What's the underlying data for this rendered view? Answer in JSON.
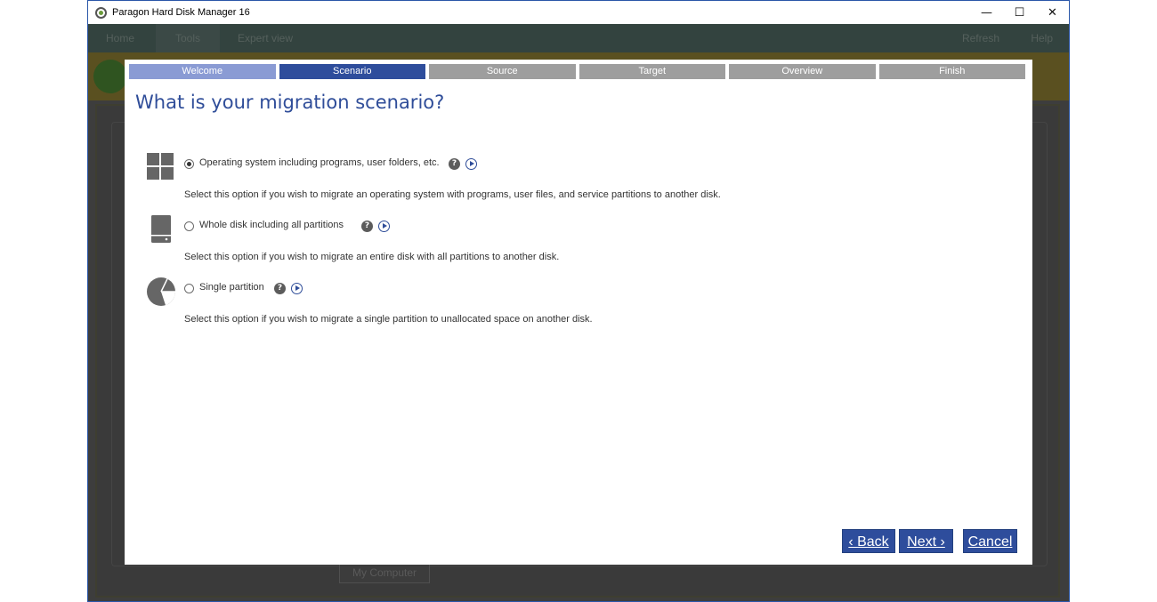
{
  "window": {
    "title": "Paragon Hard Disk Manager 16",
    "controls": {
      "minimize": "—",
      "maximize": "☐",
      "close": "✕"
    }
  },
  "background_app": {
    "menu": {
      "home": "Home",
      "tools": "Tools",
      "expert_view": "Expert view",
      "refresh": "Refresh",
      "help": "Help"
    },
    "my_computer_label": "My Computer"
  },
  "wizard": {
    "steps": [
      "Welcome",
      "Scenario",
      "Source",
      "Target",
      "Overview",
      "Finish"
    ],
    "active_step": "Scenario",
    "heading": "What is your migration scenario?",
    "options": [
      {
        "icon": "windows-logo-icon",
        "label": "Operating system including programs, user folders, etc.",
        "description": "Select this option if you wish to migrate an operating system with programs, user files, and service partitions to another disk.",
        "selected": true
      },
      {
        "icon": "hard-disk-icon",
        "label": "Whole disk including all partitions",
        "description": "Select this option if you wish to migrate an entire disk with all partitions to another disk.",
        "selected": false
      },
      {
        "icon": "pie-partition-icon",
        "label": "Single partition",
        "description": "Select this option if you wish to migrate a single partition to unallocated space on another disk.",
        "selected": false
      }
    ],
    "help_glyph": "?",
    "buttons": {
      "back": "‹ Back",
      "next": "Next ›",
      "cancel": "Cancel"
    }
  },
  "colors": {
    "accent": "#2e4d9c",
    "step_done": "#8a9bd4",
    "step_pending": "#9e9e9e"
  }
}
